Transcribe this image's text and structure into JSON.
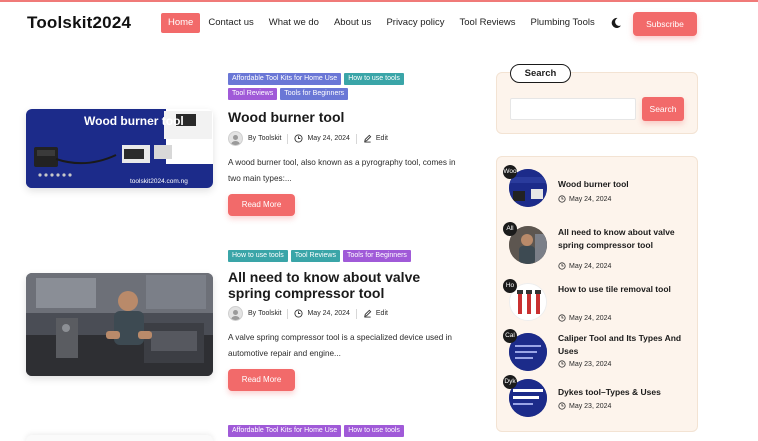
{
  "header": {
    "logo": "Toolskit2024",
    "nav": [
      "Home",
      "Contact us",
      "What we do",
      "About us",
      "Privacy policy",
      "Tool Reviews",
      "Plumbing Tools"
    ],
    "subscribe_label": "Subscribe"
  },
  "colors": {
    "accent": "#f26a6a",
    "tag_blue": "#6a77d6",
    "tag_teal": "#3aa5a8",
    "tag_purple": "#a05ad8",
    "sidebar_bg": "#fdf4ec"
  },
  "posts": [
    {
      "tags": [
        "Affordable Tool Kits for Home Use",
        "How to use tools",
        "Tool Reviews",
        "Tools for Beginners"
      ],
      "thumb_title": "Wood burner tool",
      "thumb_url": "toolskit2024.com.ng",
      "title": "Wood burner tool",
      "author_prefix": "By",
      "author": "Toolskit",
      "date": "May 24, 2024",
      "edit": "Edit",
      "excerpt": "A wood burner tool, also known as a pyrography tool, comes in two main types:...",
      "read_more": "Read More"
    },
    {
      "tags": [
        "How to use tools",
        "Tool Reviews",
        "Tools for Beginners"
      ],
      "title": "All need to know about valve spring compressor tool",
      "author_prefix": "By",
      "author": "Toolskit",
      "date": "May 24, 2024",
      "edit": "Edit",
      "excerpt": "A valve spring compressor tool is a specialized device used in automotive repair and engine...",
      "read_more": "Read More"
    },
    {
      "tags": [
        "Affordable Tool Kits for Home Use",
        "How to use tools"
      ]
    }
  ],
  "sidebar": {
    "search_title": "Search",
    "search_placeholder": "",
    "search_button": "Search",
    "recent": [
      {
        "badge": "Woo",
        "title": "Wood burner tool",
        "date": "May 24, 2024"
      },
      {
        "badge": "All",
        "title": "All need to know about valve spring compressor tool",
        "date": "May 24, 2024"
      },
      {
        "badge": "Ho",
        "title": "How to use tile removal tool",
        "date": "May 24, 2024"
      },
      {
        "badge": "Cal",
        "title": "Caliper Tool and Its Types And Uses",
        "date": "May 23, 2024"
      },
      {
        "badge": "Dyk",
        "title": "Dykes tool–Types & Uses",
        "date": "May 23, 2024"
      }
    ]
  }
}
